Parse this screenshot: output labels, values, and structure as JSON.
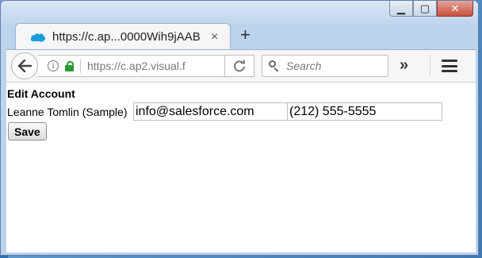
{
  "browser": {
    "tab_title": "https://c.ap...0000Wih9jAAB",
    "tab_close": "×",
    "new_tab": "+",
    "url": "https://c.ap2.visual.f",
    "search_placeholder": "Search",
    "overflow": "»",
    "icons": {
      "favicon": "salesforce-cloud-icon",
      "back": "back-arrow-icon",
      "info": "info-icon",
      "lock": "lock-icon",
      "reload": "reload-icon",
      "search": "search-icon",
      "menu": "hamburger-menu-icon"
    },
    "colors": {
      "lock": "#2a9a32",
      "favicon": "#1a9ee0"
    }
  },
  "window_controls": {
    "minimize": "▁",
    "maximize": "▢",
    "close": "✕"
  },
  "page": {
    "heading": "Edit Account",
    "name": "Leanne Tomlin (Sample)",
    "email_value": "info@salesforce.com",
    "phone_value": "(212) 555-5555",
    "save_label": "Save"
  }
}
